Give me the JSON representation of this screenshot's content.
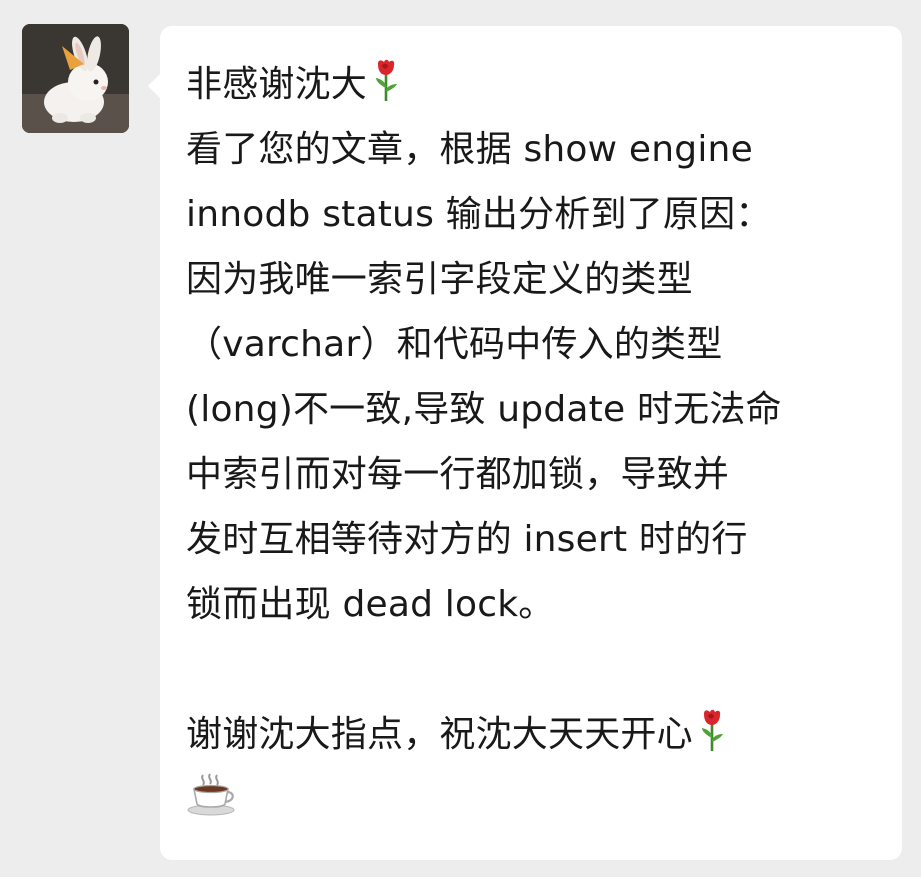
{
  "contact": {
    "avatar_icon": "white-rabbit-avatar-icon"
  },
  "message": {
    "lines": [
      "非感谢沈大",
      "看了您的文章，根据 show engine",
      "innodb status 输出分析到了原因：",
      "因为我唯一索引字段定义的类型",
      "（varchar）和代码中传入的类型",
      "(long)不一致,导致 update 时无法命",
      "中索引而对每一行都加锁，导致并",
      "发时互相等待对方的 insert 时的行",
      "锁而出现 dead lock。",
      "",
      "谢谢沈大指点，祝沈大天天开心"
    ],
    "emoji_rose": "rose-icon",
    "emoji_coffee": "hot-coffee-icon"
  },
  "colors": {
    "background": "#ededed",
    "bubble": "#ffffff",
    "text": "#191919"
  }
}
